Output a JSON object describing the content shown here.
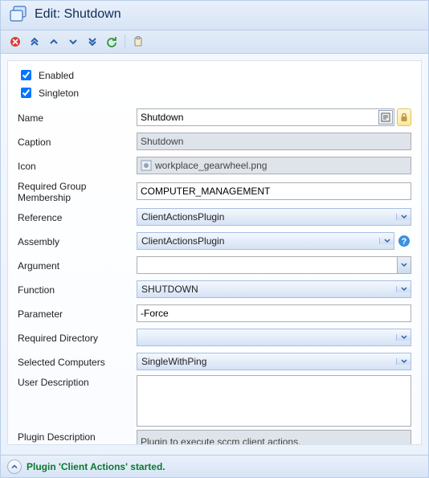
{
  "title": "Edit: Shutdown",
  "toolbar": {
    "close": "close",
    "top": "move-top",
    "up": "move-up",
    "down": "move-down",
    "bottom": "move-bottom",
    "refresh": "refresh",
    "clipboard": "clipboard"
  },
  "checkboxes": {
    "enabled": {
      "label": "Enabled",
      "checked": true
    },
    "singleton": {
      "label": "Singleton",
      "checked": true
    }
  },
  "labels": {
    "name": "Name",
    "caption": "Caption",
    "icon": "Icon",
    "required_group_membership": "Required Group Membership",
    "reference": "Reference",
    "assembly": "Assembly",
    "argument": "Argument",
    "function": "Function",
    "parameter": "Parameter",
    "required_directory": "Required Directory",
    "selected_computers": "Selected Computers",
    "user_description": "User Description",
    "plugin_description": "Plugin Description"
  },
  "fields": {
    "name": "Shutdown",
    "caption": "Shutdown",
    "icon_file": "workplace_gearwheel.png",
    "required_group_membership": "COMPUTER_MANAGEMENT",
    "reference": "ClientActionsPlugin",
    "assembly": "ClientActionsPlugin",
    "argument": "",
    "function": "SHUTDOWN",
    "parameter": "-Force",
    "required_directory": "",
    "selected_computers": "SingleWithPing",
    "user_description": "",
    "plugin_description": "Plugin to execute sccm client actions.\nValid parameter: -force"
  },
  "status": "Plugin 'Client Actions' started."
}
